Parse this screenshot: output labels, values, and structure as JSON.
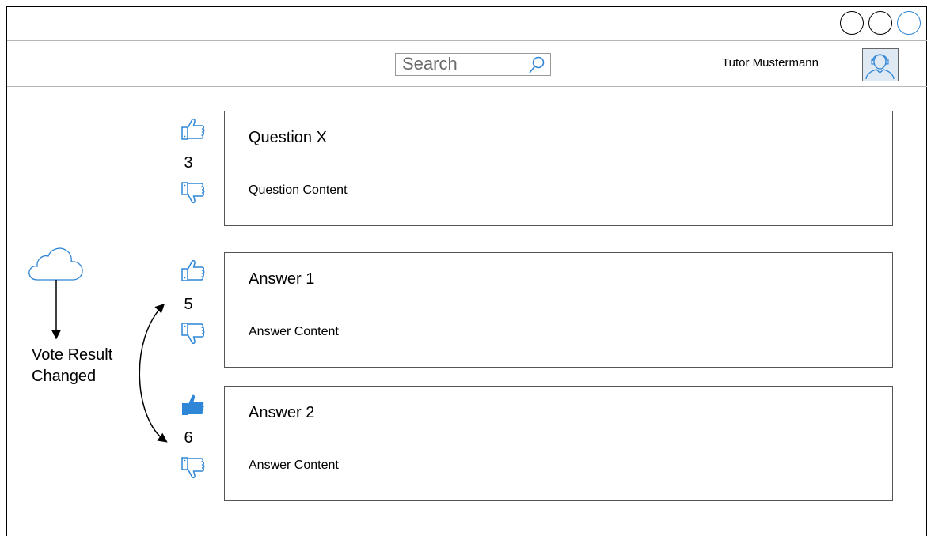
{
  "window": {
    "buttons": [
      {
        "name": "close",
        "color": "#000000"
      },
      {
        "name": "minimize",
        "color": "#000000"
      },
      {
        "name": "maximize",
        "color": "#2f86d6"
      }
    ]
  },
  "header": {
    "search": {
      "placeholder": "Search",
      "icon": "search-icon"
    },
    "user": {
      "name": "Tutor Mustermann",
      "icon": "user-avatar-icon"
    }
  },
  "posts": [
    {
      "type": "question",
      "title": "Question X",
      "content": "Question Content",
      "votes": "3",
      "upvoted": false
    },
    {
      "type": "answer",
      "title": "Answer 1",
      "content": "Answer Content",
      "votes": "5",
      "upvoted": false
    },
    {
      "type": "answer",
      "title": "Answer 2",
      "content": "Answer Content",
      "votes": "6",
      "upvoted": true
    }
  ],
  "annotation": {
    "line1": "Vote Result",
    "line2": "Changed",
    "icon": "cloud-icon"
  },
  "colors": {
    "accent": "#2f86d6",
    "border": "#555555"
  }
}
